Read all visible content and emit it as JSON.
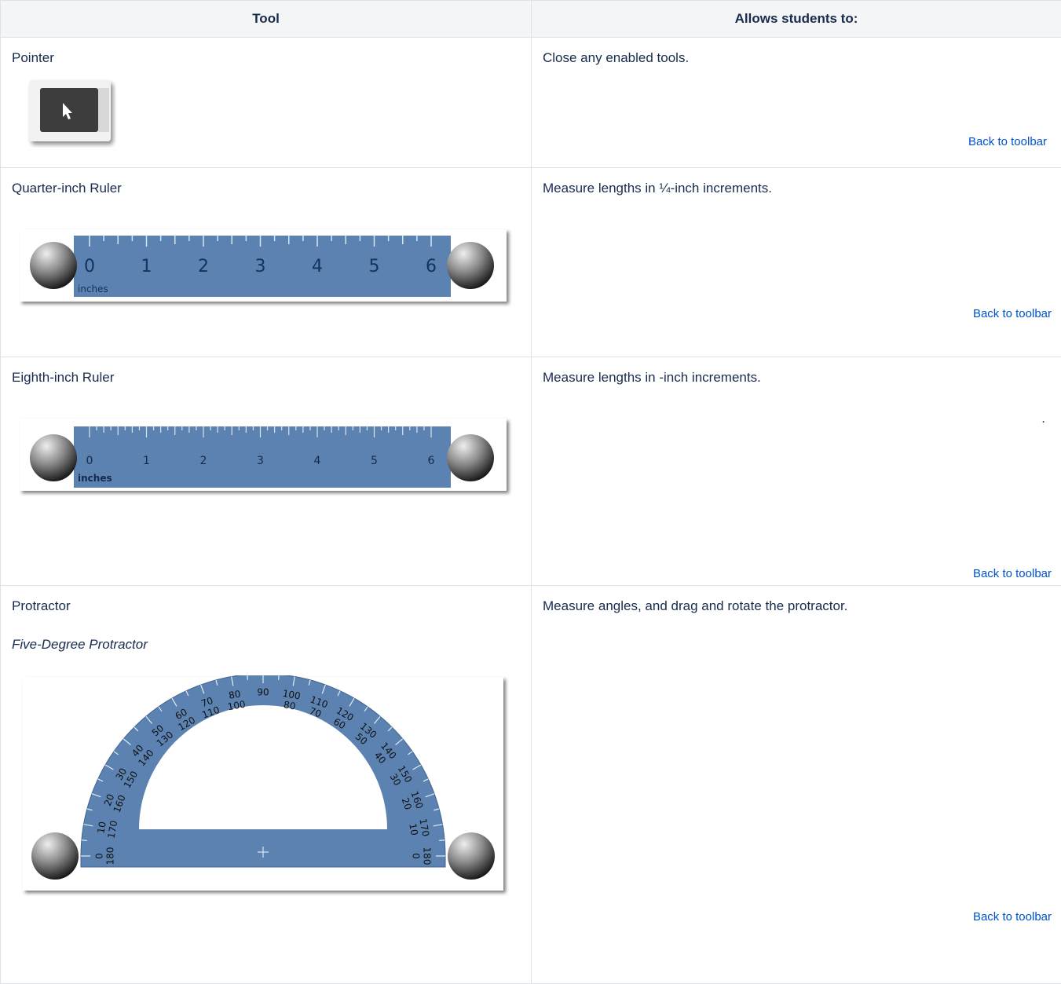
{
  "headers": {
    "tool": "Tool",
    "allows": "Allows students to:"
  },
  "rows": [
    {
      "tool": "Pointer",
      "desc": "Close any enabled tools.",
      "back": "Back to toolbar"
    },
    {
      "tool": "Quarter-inch Ruler",
      "desc": "Measure lengths in ¼-inch increments.",
      "back": "Back to toolbar",
      "ruler_numbers": [
        "0",
        "1",
        "2",
        "3",
        "4",
        "5",
        "6"
      ],
      "ruler_unit": "inches"
    },
    {
      "tool": "Eighth-inch Ruler",
      "desc": "Measure lengths in -inch increments.",
      "stray": ".",
      "back": "Back to toolbar",
      "ruler_numbers": [
        "0",
        "1",
        "2",
        "3",
        "4",
        "5",
        "6"
      ],
      "ruler_unit": "inches"
    },
    {
      "tool": "Protractor",
      "subtitle": "Five-Degree Protractor",
      "desc": "Measure angles, and drag and rotate the protractor.",
      "back": "Back to toolbar",
      "outer_labels": [
        "0",
        "10",
        "20",
        "30",
        "40",
        "50",
        "60",
        "70",
        "80",
        "90",
        "100",
        "110",
        "120",
        "130",
        "140",
        "150",
        "160",
        "170",
        "180"
      ],
      "inner_labels": [
        "180",
        "170",
        "160",
        "150",
        "140",
        "130",
        "120",
        "110",
        "100",
        "",
        "80",
        "70",
        "60",
        "50",
        "40",
        "30",
        "20",
        "10",
        "0"
      ]
    }
  ],
  "colors": {
    "ruler_blue": "#5b82b0",
    "link": "#0052cc",
    "header_bg": "#f4f5f7"
  }
}
